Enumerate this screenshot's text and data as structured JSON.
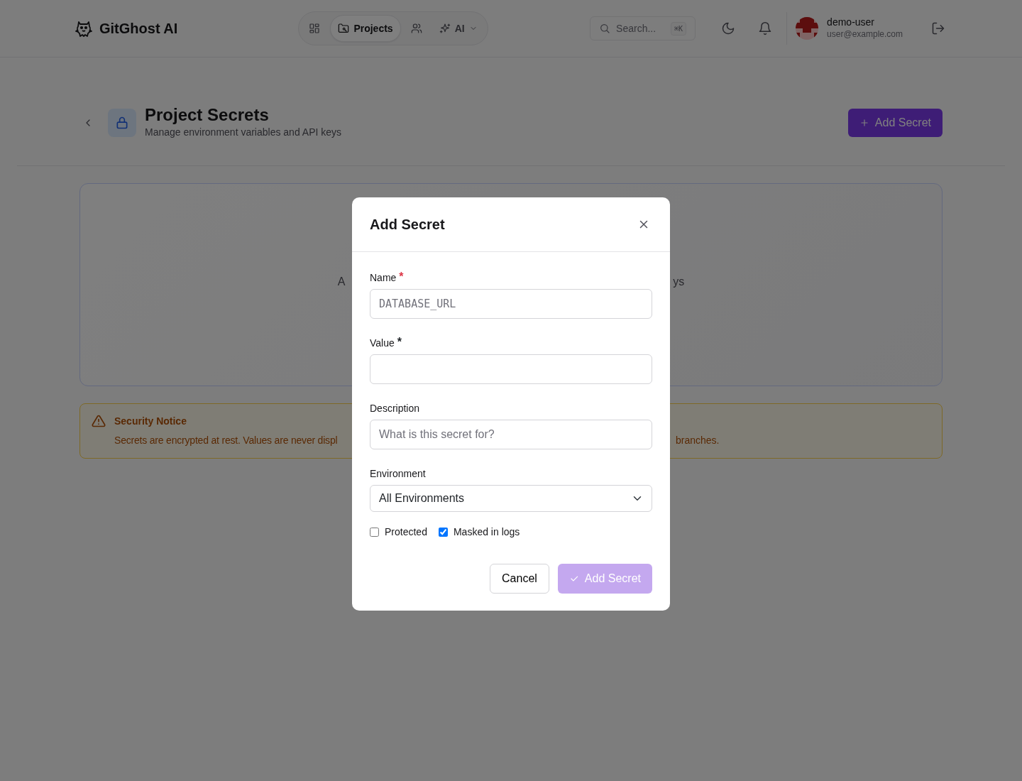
{
  "brand": {
    "name": "GitGhost AI"
  },
  "nav": [
    {
      "kind": "icon",
      "selected": false
    },
    {
      "kind": "text",
      "label": "Projects",
      "selected": true
    },
    {
      "kind": "icon",
      "selected": false
    },
    {
      "kind": "dropdown",
      "label": "AI",
      "selected": false
    }
  ],
  "search": {
    "placeholder": "Search...",
    "shortcut": "⌘K"
  },
  "user": {
    "name": "demo-user",
    "email": "user@example.com"
  },
  "page": {
    "title": "Project Secrets",
    "subtitle": "Manage environment variables and API keys",
    "add_button": "Add Secret"
  },
  "empty_state": {
    "left_fragment": "A",
    "right_fragment": "ys"
  },
  "notice": {
    "title": "Security Notice",
    "left_fragment": "Secrets are encrypted at rest. Values are never displ",
    "right_fragment": "branches."
  },
  "modal": {
    "title": "Add Secret",
    "fields": [
      {
        "kind": "text",
        "label": "Name",
        "marker": {
          "text": "*",
          "color": "#dc3545"
        },
        "placeholder": "DATABASE_URL",
        "mono": true
      },
      {
        "kind": "text",
        "label": "Value",
        "marker": {
          "text": "*",
          "color": "#212529"
        }
      },
      {
        "kind": "text",
        "label": "Description",
        "placeholder": "What is this secret for?"
      },
      {
        "kind": "select",
        "label": "Environment",
        "value": "All Environments"
      }
    ],
    "checkboxes": [
      {
        "label": "Protected",
        "checked": false
      },
      {
        "label": "Masked in logs",
        "checked": true
      }
    ],
    "cancel": "Cancel",
    "submit": {
      "label": "Add Secret",
      "disabled": true
    }
  }
}
